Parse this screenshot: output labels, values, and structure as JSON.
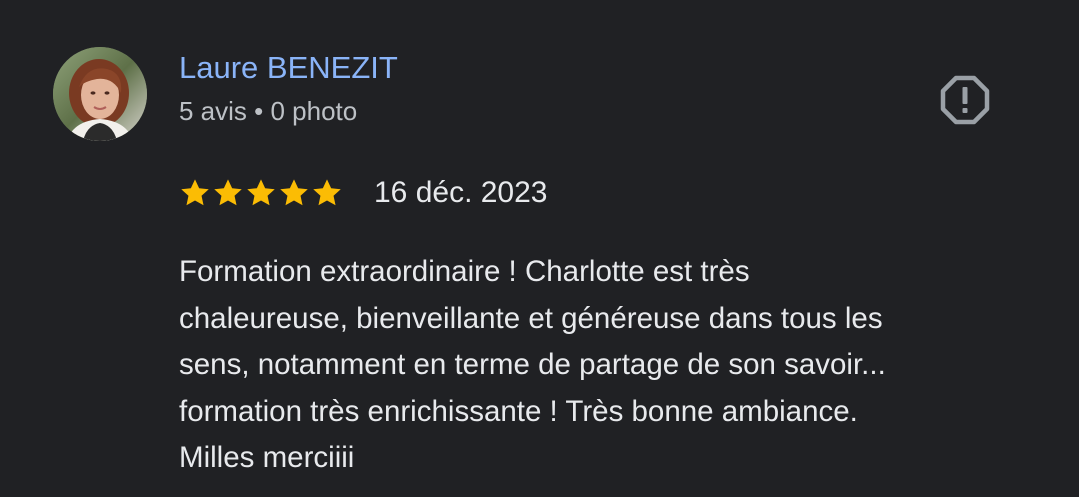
{
  "review": {
    "author": {
      "name": "Laure BENEZIT",
      "meta": "5 avis • 0 photo",
      "avatar_icon": "profile-photo"
    },
    "report_icon": "report-flag-icon",
    "rating": {
      "stars": 5,
      "max": 5,
      "star_color": "#fbbc04"
    },
    "date": "16 déc. 2023",
    "text_lines": [
      "Formation extraordinaire ! Charlotte est très",
      "chaleureuse, bienveillante et généreuse dans tous les",
      "sens, notamment en terme de partage de son savoir...",
      "formation très enrichissante ! Très bonne ambiance.",
      "Milles merciiii"
    ]
  },
  "colors": {
    "background": "#202124",
    "author_name": "#8ab4f8",
    "meta_text": "#bdc1c6",
    "body_text": "#e8eaed",
    "icon": "#9aa0a6"
  }
}
